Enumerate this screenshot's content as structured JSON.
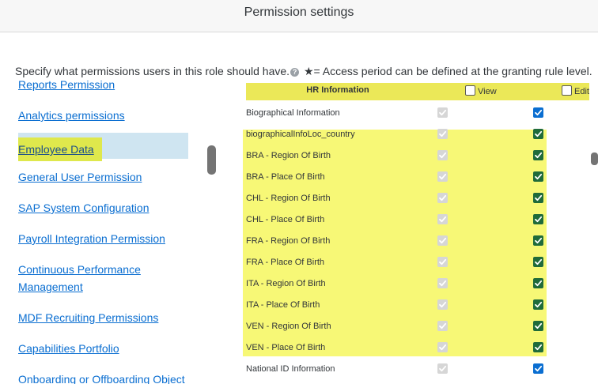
{
  "dialog": {
    "title": "Permission settings"
  },
  "description": {
    "text": "Specify what permissions users in this role should have.",
    "legend": "★= Access period can be defined at the granting rule level."
  },
  "icons": {
    "info": "info-icon",
    "check": "check-icon",
    "star": "star-icon"
  },
  "colors": {
    "link": "#0a6ed1",
    "highlight": "#f7f876",
    "selected_bg": "#cfe5f1",
    "checkbox_blue": "#0a6ed1",
    "checkbox_green": "#1f6b3a"
  },
  "nav": {
    "selected": "Employee Data",
    "items": [
      {
        "label": "Reports Permission"
      },
      {
        "label": "Analytics permissions"
      },
      {
        "label": "Employee Data"
      },
      {
        "label": "General User Permission"
      },
      {
        "label": "SAP System Configuration"
      },
      {
        "label": "Payroll Integration Permission"
      },
      {
        "label": "Continuous Performance"
      },
      {
        "label": "Management"
      },
      {
        "label": "MDF Recruiting Permissions"
      },
      {
        "label": "Capabilities Portfolio"
      },
      {
        "label": "Onboarding or Offboarding Object"
      }
    ]
  },
  "grid": {
    "header": {
      "title": "HR Information",
      "view_label": "View",
      "edit_label": "Edit",
      "view_checked": false,
      "edit_checked": false
    },
    "rows": [
      {
        "label": "Biographical Information",
        "view": true,
        "edit": true
      },
      {
        "label": "biographicalInfoLoc_country",
        "view": true,
        "edit": true
      },
      {
        "label": "BRA - Region Of Birth",
        "view": true,
        "edit": true
      },
      {
        "label": "BRA - Place Of Birth",
        "view": true,
        "edit": true
      },
      {
        "label": "CHL - Region Of Birth",
        "view": true,
        "edit": true
      },
      {
        "label": "CHL - Place Of Birth",
        "view": true,
        "edit": true
      },
      {
        "label": "FRA - Region Of Birth",
        "view": true,
        "edit": true
      },
      {
        "label": "FRA - Place Of Birth",
        "view": true,
        "edit": true
      },
      {
        "label": "ITA - Region Of Birth",
        "view": true,
        "edit": true
      },
      {
        "label": "ITA - Place Of Birth",
        "view": true,
        "edit": true
      },
      {
        "label": "VEN - Region Of Birth",
        "view": true,
        "edit": true
      },
      {
        "label": "VEN - Place Of Birth",
        "view": true,
        "edit": true
      },
      {
        "label": "National ID Information",
        "view": true,
        "edit": true
      }
    ]
  }
}
